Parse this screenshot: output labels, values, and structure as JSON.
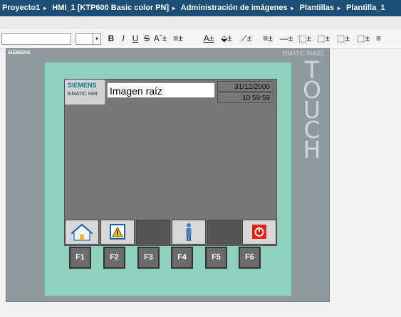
{
  "breadcrumb": [
    "Proyecto1",
    "HMI_1 [KTP600 Basic color PN]",
    "Administración de imágenes",
    "Plantillas",
    "Plantilla_1"
  ],
  "breadcrumb_sep": "▸",
  "toolbar": {
    "dropdown_arrow": "▾",
    "buttons": [
      "B",
      "I",
      "U",
      "S",
      "Aˆ±",
      "≡±",
      "A±",
      "⬙±",
      "⟋±",
      "≡±",
      "—±",
      "⬚±",
      "⬚±",
      "⬚±",
      "⬚±",
      "≡"
    ]
  },
  "panel": {
    "brand": "SIEMENS",
    "model_label": "SIMATIC PANEL",
    "touch_label": "TOUCH"
  },
  "screen": {
    "logo_brand": "SIEMENS",
    "logo_sub": "SIMATIC HMI",
    "title": "Imagen raíz",
    "date": "31/12/2000",
    "time": "10:59:59"
  },
  "nav_buttons": [
    "home",
    "alarm",
    "blank",
    "user",
    "blank",
    "stop"
  ],
  "fkeys": [
    "F1",
    "F2",
    "F3",
    "F4",
    "F5",
    "F6"
  ],
  "colors": {
    "breadcrumb_bg": "#1d4e74",
    "bezel": "#8fcfbd",
    "screen": "#777777",
    "siemens_teal": "#127e86",
    "stop_red": "#e2231a"
  }
}
